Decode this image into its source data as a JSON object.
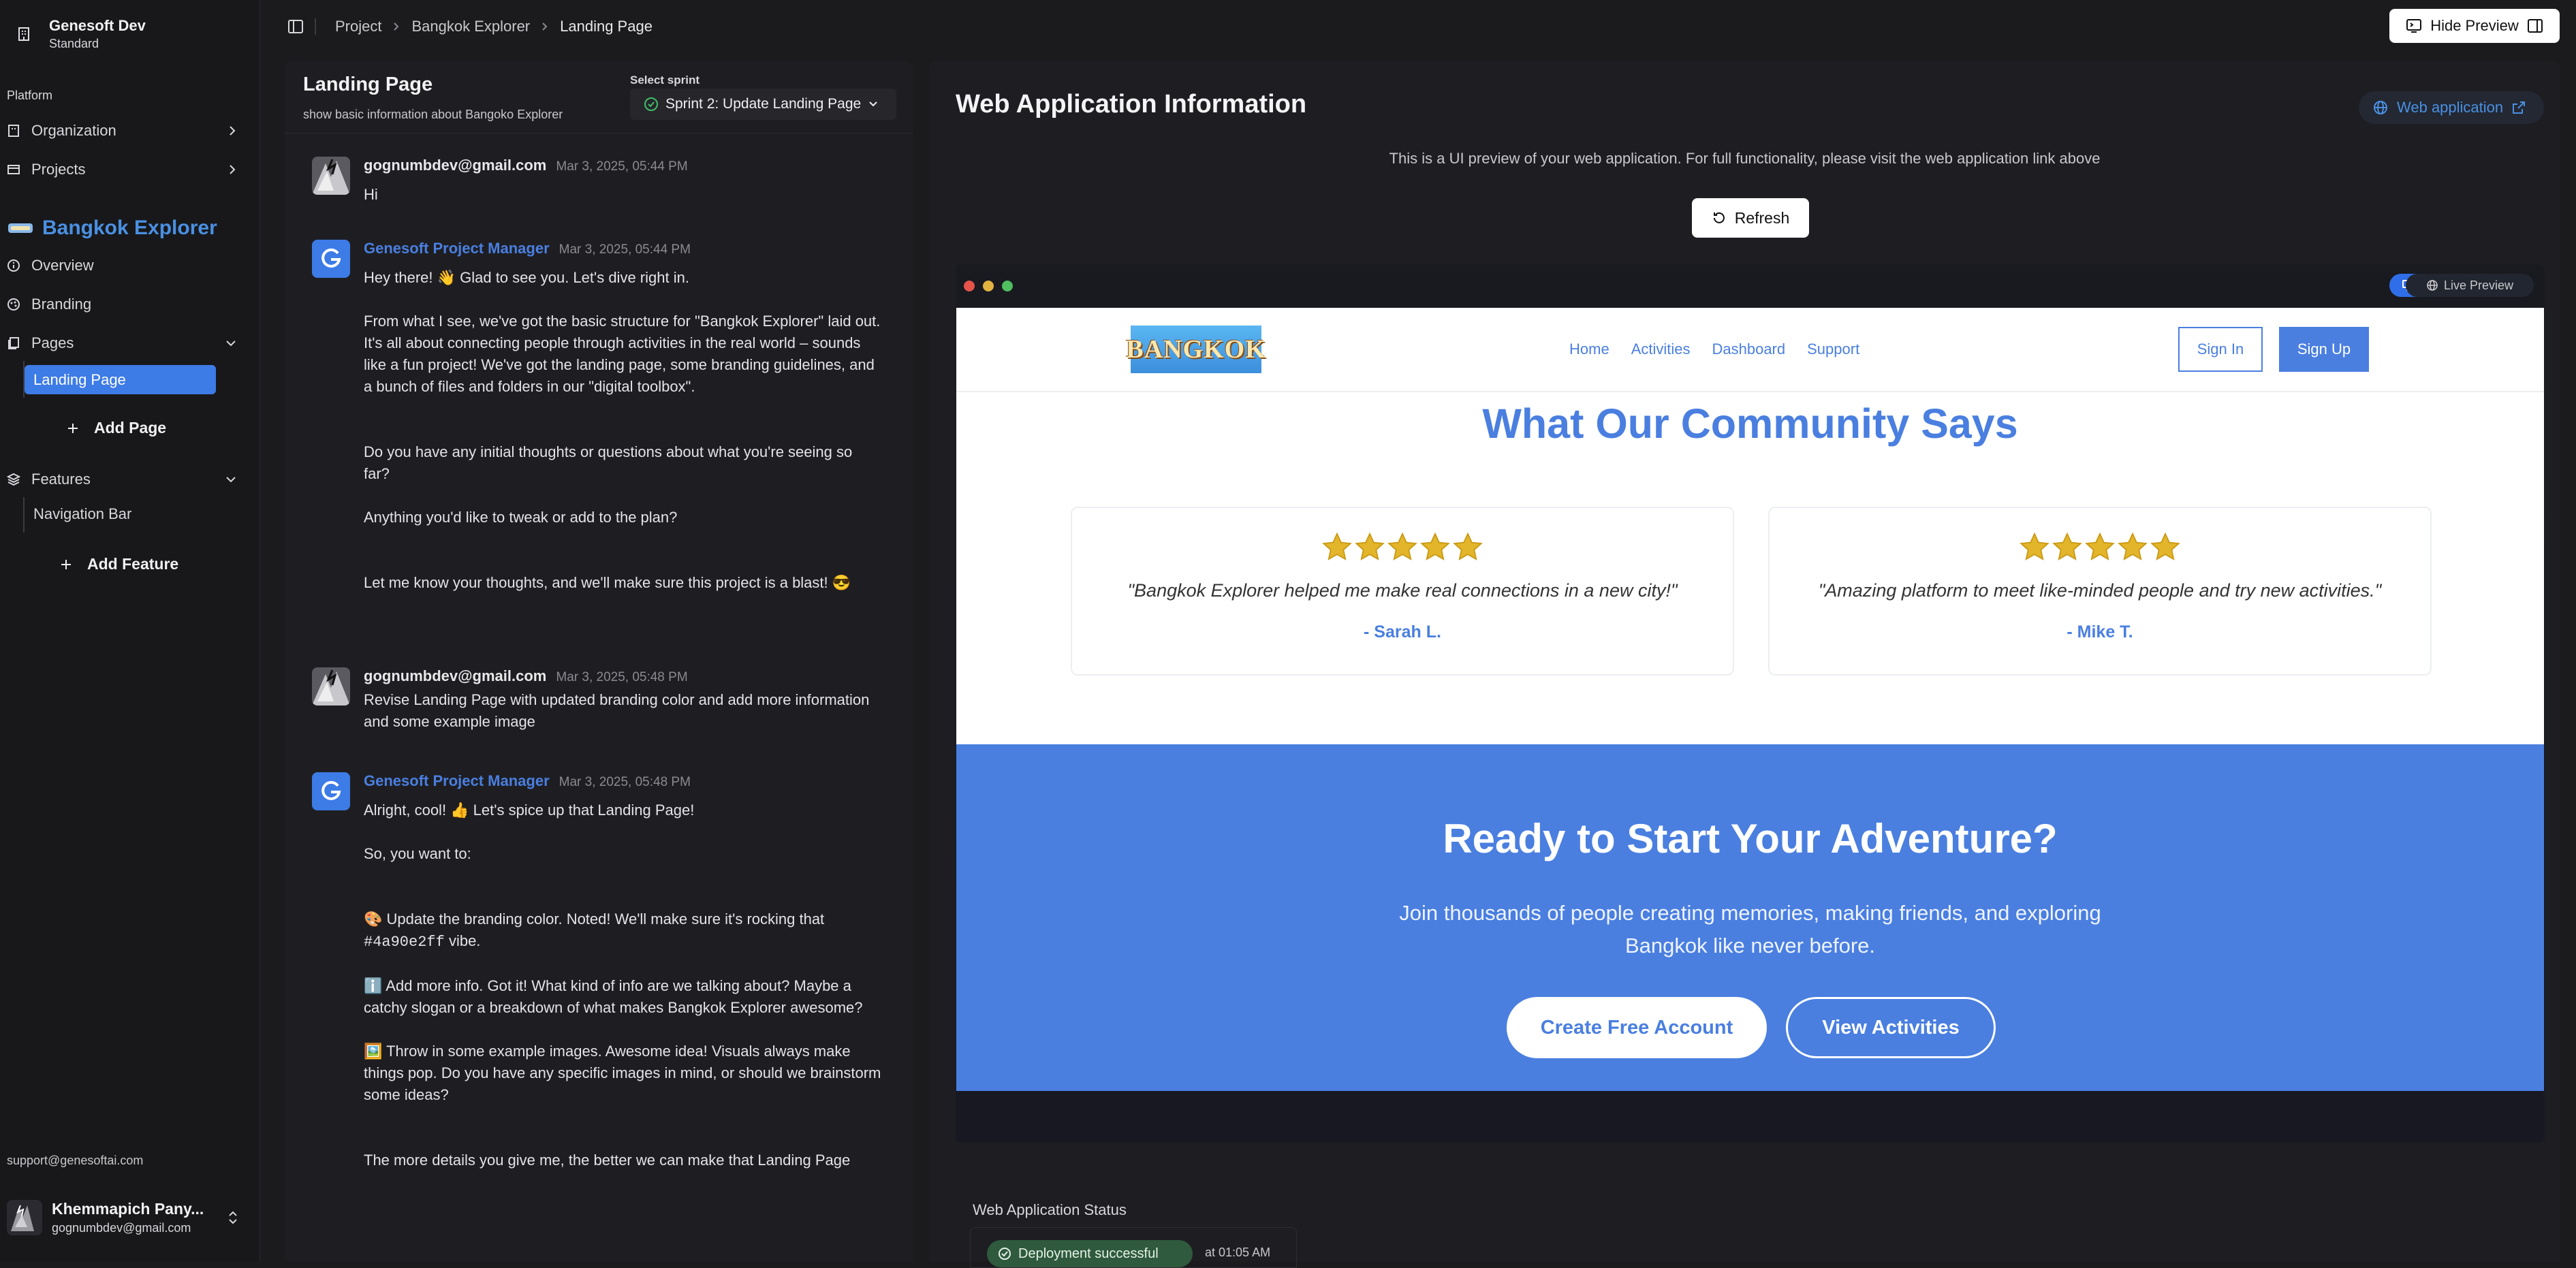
{
  "sidebar": {
    "workspace_name": "Genesoft Dev",
    "workspace_plan": "Standard",
    "section_label": "Platform",
    "organization": "Organization",
    "projects": "Projects",
    "project_name": "Bangkok Explorer",
    "overview": "Overview",
    "branding": "Branding",
    "pages": "Pages",
    "selected_page": "Landing Page",
    "add_page": "Add Page",
    "features": "Features",
    "feature_item": "Navigation Bar",
    "add_feature": "Add Feature",
    "support_email": "support@genesoftai.com",
    "user_name": "Khemmapich Pany...",
    "user_email": "gognumbdev@gmail.com"
  },
  "topbar": {
    "breadcrumbs": [
      "Project",
      "Bangkok Explorer",
      "Landing Page"
    ],
    "hide_preview": "Hide Preview"
  },
  "chat": {
    "title": "Landing Page",
    "subtitle": "show basic information about Bangoko Explorer",
    "sprint_label": "Select sprint",
    "sprint_value": "Sprint 2: Update Landing Page",
    "messages": [
      {
        "author": "gognumbdev@gmail.com",
        "time": "Mar 3, 2025, 05:44 PM",
        "lines": [
          "Hi"
        ]
      },
      {
        "author": "Genesoft Project Manager",
        "time": "Mar 3, 2025, 05:44 PM",
        "lines": [
          "Hey there! 👋 Glad to see you. Let's dive right in.",
          "From what I see, we've got the basic structure for \"Bangkok Explorer\" laid out. It's all about connecting people through activities in the real world – sounds like a fun project! We've got the landing page, some branding guidelines, and a bunch of files and folders in our \"digital toolbox\".",
          "Do you have any initial thoughts or questions about what you're seeing so far?",
          "Anything you'd like to tweak or add to the plan?",
          "Let me know your thoughts, and we'll make sure this project is a blast! 😎"
        ]
      },
      {
        "author": "gognumbdev@gmail.com",
        "time": "Mar 3, 2025, 05:48 PM",
        "lines": [
          "Revise Landing Page with updated branding color and add more information and some example image"
        ]
      },
      {
        "author": "Genesoft Project Manager",
        "time": "Mar 3, 2025, 05:48 PM",
        "lines": [
          "Alright, cool! 👍 Let's spice up that Landing Page!",
          "So, you want to:",
          "🎨 Update the branding color. Noted! We'll make sure it's rocking that",
          "#4a90e2ff",
          "vibe.",
          "ℹ️ Add more info. Got it! What kind of info are we talking about? Maybe a catchy slogan or a breakdown of what makes Bangkok Explorer awesome?",
          "🖼️ Throw in some example images. Awesome idea! Visuals always make things pop. Do you have any specific images in mind, or should we brainstorm some ideas?",
          "The more details you give me, the better we can make that Landing Page"
        ]
      }
    ]
  },
  "preview": {
    "title": "Web Application Information",
    "web_link": "Web application",
    "note": "This is a UI preview of your web application. For full functionality, please visit the web application link above",
    "refresh": "Refresh",
    "live_preview": "Live Preview",
    "status_label": "Web Application Status",
    "deploy_status": "Deployment successful",
    "deploy_time": "at 01:05 AM",
    "site": {
      "logo_text": "BANGKOK",
      "nav_links": [
        "Home",
        "Activities",
        "Dashboard",
        "Support"
      ],
      "sign_in": "Sign In",
      "sign_up": "Sign Up",
      "community_title": "What Our Community Says",
      "testimonials": [
        {
          "quote": "\"Bangkok Explorer helped me make real connections in a new city!\"",
          "author": "- Sarah L.",
          "stars": 5
        },
        {
          "quote": "\"Amazing platform to meet like-minded people and try new activities.\"",
          "author": "- Mike T.",
          "stars": 5
        }
      ],
      "cta_title": "Ready to Start Your Adventure?",
      "cta_sub": "Join thousands of people creating memories, making friends, and exploring Bangkok like never before.",
      "cta_primary": "Create Free Account",
      "cta_secondary": "View Activities"
    }
  },
  "colors": {
    "accent": "#4a90e2",
    "brand_blue": "#4a7fe0",
    "selected": "#3d7be6",
    "star": "#e3b52a",
    "success": "#2f5a3d"
  }
}
